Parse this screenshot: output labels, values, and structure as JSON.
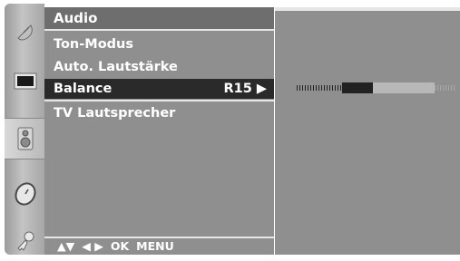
{
  "menu": {
    "title": "Audio",
    "items": [
      {
        "label": "Ton-Modus",
        "value": ""
      },
      {
        "label": "Auto. Lautstärke",
        "value": ""
      },
      {
        "label": "Balance",
        "value": "R15 ▶"
      },
      {
        "label": "TV Lautsprecher",
        "value": ""
      }
    ],
    "selected_index": 2
  },
  "footer": {
    "nav_updown": "▲▼",
    "nav_leftright": "◀ ▶",
    "ok": "OK",
    "menu": "MENU"
  },
  "rail_icons": [
    "satellite-dish-icon",
    "tv-screen-icon",
    "speaker-icon",
    "clock-icon",
    "key-icon"
  ],
  "active_rail_icon": "speaker-icon",
  "balance": {
    "value_label": "R15",
    "position_fraction": 0.65
  },
  "colors": {
    "panel": "#8f8f8f",
    "title_bar": "#6e6e6e",
    "selected_row": "#2a2a2a",
    "text": "#ffffff"
  }
}
